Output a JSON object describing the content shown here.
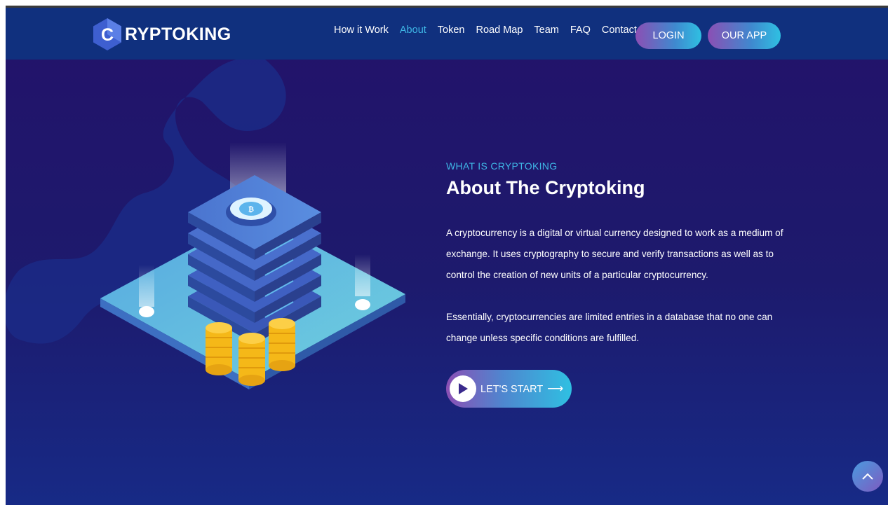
{
  "brand": {
    "logo_letter": "C",
    "name_rest": "RYPTOKING"
  },
  "nav": {
    "items": [
      {
        "label": "How it Work",
        "active": false
      },
      {
        "label": "About",
        "active": true
      },
      {
        "label": "Token",
        "active": false
      },
      {
        "label": "Road Map",
        "active": false
      },
      {
        "label": "Team",
        "active": false
      },
      {
        "label": "FAQ",
        "active": false
      },
      {
        "label": "Contact",
        "active": false
      }
    ],
    "login_label": "LOGIN",
    "app_label": "OUR APP"
  },
  "about": {
    "eyebrow": "WHAT IS CRYPTOKING",
    "title": "About The Cryptoking",
    "paragraph1": "A cryptocurrency is a digital or virtual currency designed to work as a medium of exchange. It uses cryptography to secure and verify transactions as well as to control the creation of new units of a particular cryptocurrency.",
    "paragraph2": "Essentially, cryptocurrencies are limited entries in a database that no one can change unless specific conditions are fulfilled.",
    "cta_label": "LET'S START",
    "cta_arrow": "⟶"
  },
  "icons": {
    "play": "play-icon",
    "scroll_top": "chevron-up-icon",
    "illustration": "crypto-server-illustration"
  },
  "colors": {
    "header_bg": "#10307e",
    "accent": "#3fb7e6",
    "gradient_start": "#8b4fb4",
    "gradient_end": "#2fc0e2",
    "background": "#1d1a6d"
  }
}
